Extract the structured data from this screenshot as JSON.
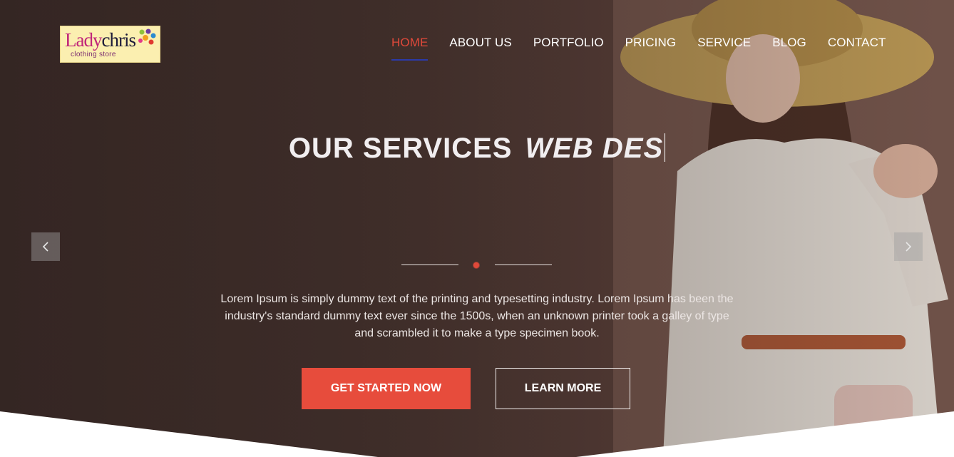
{
  "logo": {
    "main_a": "Lady",
    "main_b": "chris",
    "sub": "clothing store"
  },
  "nav": {
    "items": [
      {
        "label": "HOME",
        "active": true
      },
      {
        "label": "ABOUT US"
      },
      {
        "label": "PORTFOLIO"
      },
      {
        "label": "PRICING"
      },
      {
        "label": "SERVICE"
      },
      {
        "label": "BLOG"
      },
      {
        "label": "CONTACT"
      }
    ]
  },
  "hero": {
    "headline_static": "OUR SERVICES",
    "headline_typed": "WEB DES",
    "description": "Lorem Ipsum is simply dummy text of the printing and typesetting industry. Lorem Ipsum has been the industry's standard dummy text ever since the 1500s, when an unknown printer took a galley of type and scrambled it to make a type specimen book.",
    "primary_button": "GET STARTED NOW",
    "secondary_button": "LEARN MORE",
    "prev_arrow": "‹",
    "next_arrow": "›"
  },
  "colors": {
    "accent": "#e74c3c",
    "nav_underline": "#2c3aa8",
    "hero_bg": "#4a3631"
  }
}
